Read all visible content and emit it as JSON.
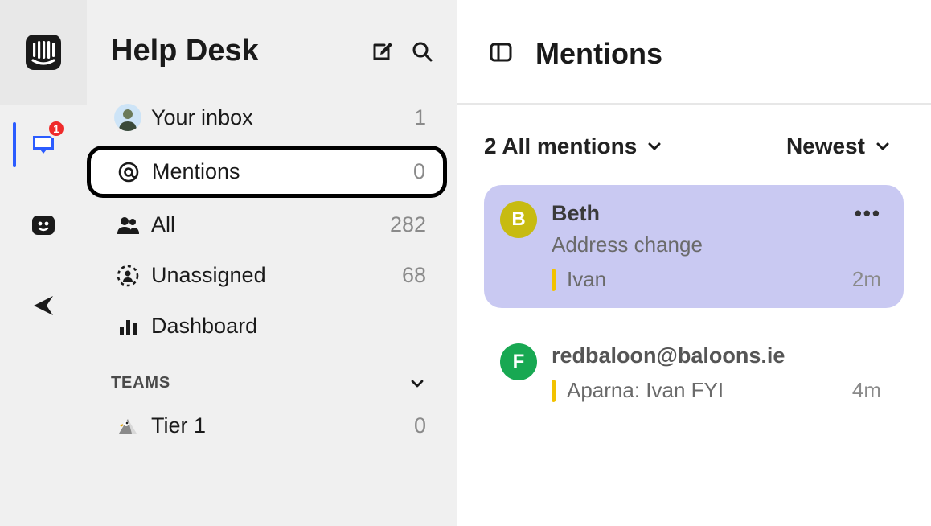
{
  "rail": {
    "inbox_badge": "1"
  },
  "sidebar": {
    "title": "Help Desk",
    "items": [
      {
        "label": "Your inbox",
        "count": "1"
      },
      {
        "label": "Mentions",
        "count": "0"
      },
      {
        "label": "All",
        "count": "282"
      },
      {
        "label": "Unassigned",
        "count": "68"
      },
      {
        "label": "Dashboard",
        "count": ""
      }
    ],
    "teams_header": "TEAMS",
    "teams": [
      {
        "label": "Tier 1",
        "count": "0"
      }
    ]
  },
  "main": {
    "title": "Mentions",
    "filter_label": "2 All mentions",
    "sort_label": "Newest",
    "conversations": [
      {
        "initial": "B",
        "avatar_color": "#c7bb11",
        "name": "Beth",
        "subject": "Address change",
        "snippet": "Ivan",
        "time": "2m",
        "selected": true
      },
      {
        "initial": "F",
        "avatar_color": "#18a852",
        "name": "redbaloon@baloons.ie",
        "subject": "",
        "snippet": "Aparna: Ivan FYI",
        "time": "4m",
        "selected": false
      }
    ]
  }
}
